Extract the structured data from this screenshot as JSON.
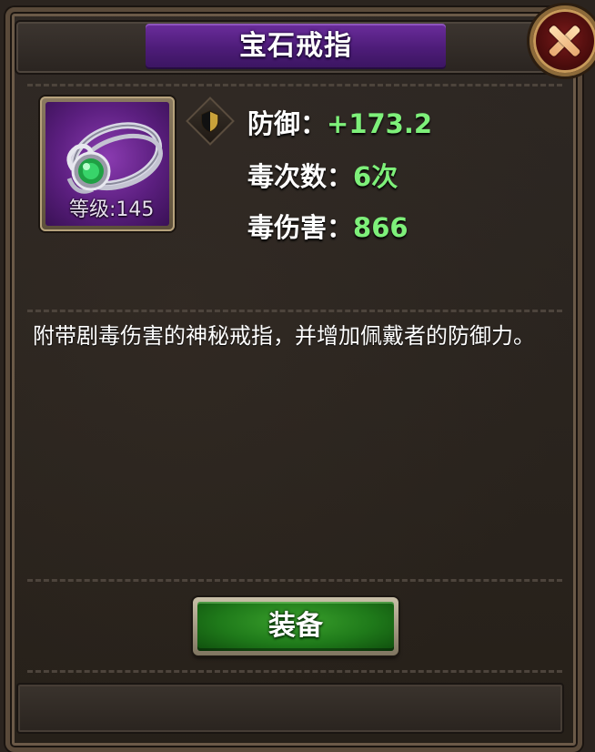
{
  "dialog": {
    "title": "宝石戒指"
  },
  "item": {
    "icon": "gem-ring-icon",
    "level_label": "等级:145"
  },
  "stats": [
    {
      "icon": "shield-icon",
      "label": "防御：",
      "value": "+173.2"
    },
    {
      "label": "毒次数：",
      "value": "6次"
    },
    {
      "label": "毒伤害：",
      "value": "866"
    }
  ],
  "description": "附带剧毒伤害的神秘戒指，并增加佩戴者的防御力。",
  "actions": {
    "equip_label": "装备"
  },
  "colors": {
    "title_plate": "#5a2388",
    "stat_value": "#7ef07a",
    "equip_button": "#2a8c22",
    "close_button": "#6a1414"
  }
}
